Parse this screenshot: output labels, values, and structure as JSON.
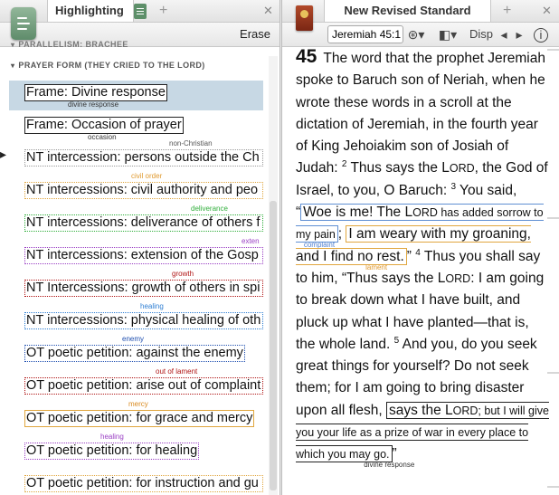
{
  "left_panel": {
    "tab_title": "Highlighting",
    "erase_label": "Erase",
    "section_above": "PARALLELISM: BRACHEE",
    "section_title": "PRAYER FORM (THEY CRIED TO THE LORD)",
    "rows": [
      {
        "label": "Frame: Divine response",
        "tag": "divine response",
        "tag_color": "#333333",
        "border": "1px solid #222222",
        "bg": "#ffffff",
        "row_bg": "#c7d8e4",
        "full": false
      },
      {
        "label": "Frame: Occasion of prayer",
        "tag": "occasion",
        "tag_color": "#333333",
        "border": "1px solid #222222",
        "bg": "#ffffff",
        "row_bg": "",
        "full": false
      },
      {
        "label": "NT intercession: persons outside the Ch",
        "tag": "non-Christian",
        "tag_color": "#555555",
        "border": "1px dotted #9a9a9a",
        "bg": "#ffffff",
        "row_bg": "",
        "full": true
      },
      {
        "label": "NT intercessions: civil authority and peo",
        "tag": "civil order",
        "tag_color": "#e09a30",
        "border": "1px dotted #e0a63e",
        "bg": "#ffffff",
        "row_bg": "",
        "full": true
      },
      {
        "label": "NT intercessions: deliverance of others f",
        "tag": "deliverance",
        "tag_color": "#2fae3a",
        "border": "1px dotted #2fae3a",
        "bg": "#ffffff",
        "row_bg": "",
        "full": true
      },
      {
        "label": "NT intercessions: extension of the Gosp",
        "tag": "exten",
        "tag_color": "#9a3fc4",
        "border": "1px dotted #9a3fc4",
        "bg": "#ffffff",
        "row_bg": "",
        "full": true
      },
      {
        "label": "NT Intercessions: growth of others in spi",
        "tag": "growth",
        "tag_color": "#b01515",
        "border": "1px dotted #b01515",
        "bg": "#ffffff",
        "row_bg": "",
        "full": true
      },
      {
        "label": "NT intercessions: physical healing of oth",
        "tag": "healing",
        "tag_color": "#2f7fd3",
        "border": "1px dotted #2f7fd3",
        "bg": "#ffffff",
        "row_bg": "",
        "full": true
      },
      {
        "label": "OT poetic petition: against the enemy",
        "tag": "enemy",
        "tag_color": "#1f4fb0",
        "border": "1px dotted #1f4fb0",
        "bg": "#ffffff",
        "row_bg": "",
        "full": false
      },
      {
        "label": "OT poetic petition: arise out of complaint",
        "tag": "out of lament",
        "tag_color": "#b01515",
        "border": "1px dotted #b01515",
        "bg": "#ffffff",
        "row_bg": "",
        "full": true
      },
      {
        "label": "OT poetic petition: for grace and mercy",
        "tag": "mercy",
        "tag_color": "#d98a1f",
        "border": "1px solid #e0a63e",
        "bg": "#ffffff",
        "row_bg": "",
        "full": false
      },
      {
        "label": "OT poetic petition: for healing",
        "tag": "healing",
        "tag_color": "#9a3fc4",
        "border": "1px dotted #9a3fc4",
        "bg": "#ffffff",
        "row_bg": "",
        "full": false
      },
      {
        "label": "OT poetic petition: for instruction and gu",
        "tag": "",
        "tag_color": "#333333",
        "border": "1px dotted #e0a63e",
        "bg": "#ffffff",
        "row_bg": "",
        "full": true
      }
    ]
  },
  "right_panel": {
    "tab_title": "New Revised Standard Version",
    "reference_value": "Jeremiah 45:1",
    "display_label": "Disp",
    "chapter": "45",
    "text": {
      "p1": "The word that the prophet Jeremiah spoke to Baruch son of Neriah, when he wrote these words in a scroll at the dictation of Jeremiah, in the fourth year of King Jehoiakim son of Josiah of Judah:",
      "v2": "2",
      "p2a": "Thus says the",
      "lord1a": "L",
      "lord1b": "ORD",
      "p2b": ", the God of Israel, to you, O Baruch:",
      "v3": "3",
      "p3a": "You said, “",
      "hl1a": "Woe is me! The",
      "hl1b": "ORD has added sorrow to my pain",
      "tag_complaint": "complaint",
      "p3b": ";",
      "hl2": "I am weary with my groaning, and I find no rest.",
      "tag_lament": "lament",
      "p3c": "”",
      "v4": "4",
      "p4a": "Thus you shall say to him, “Thus says the",
      "p4b": ": I am going to break down what I have built, and pluck up what I have planted—that is, the whole land.",
      "v5": "5",
      "p5a": "And you, do you seek great things for yourself? Do not seek them; for I am going to bring disaster upon all flesh,",
      "hl3a": "says the",
      "hl3b": "ORD; but I will give you your life as a prize of war in every place to which you may go.",
      "tag_divine": "divine response",
      "p5b": "”"
    }
  }
}
